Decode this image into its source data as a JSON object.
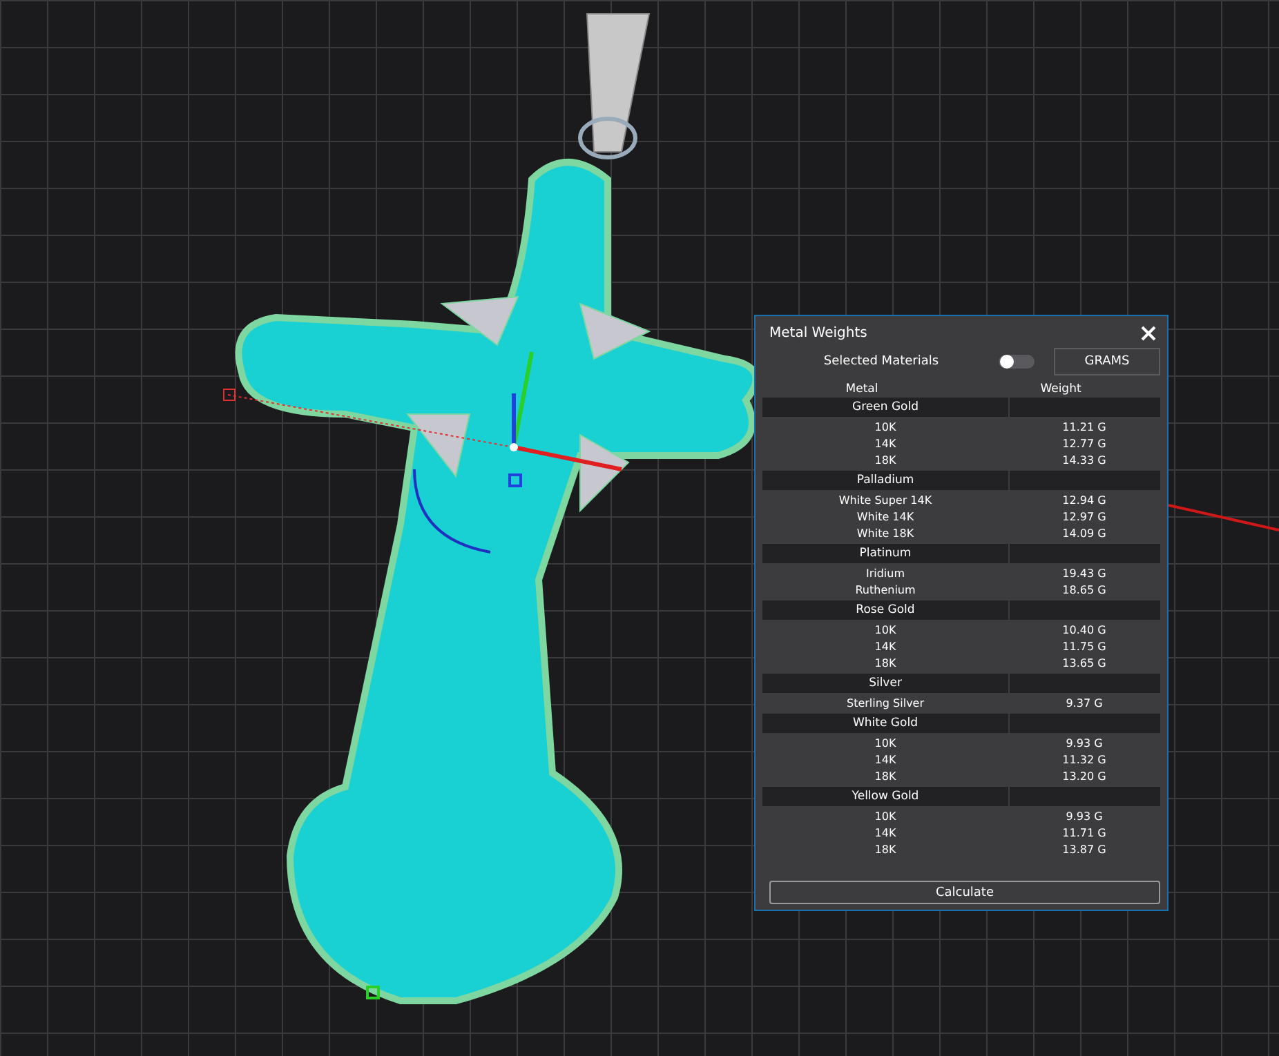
{
  "panel": {
    "title": "Metal Weights",
    "selected_materials": {
      "label": "Selected Materials",
      "on": false
    },
    "unit_button": "GRAMS",
    "columns": [
      "Metal",
      "Weight"
    ],
    "groups": [
      {
        "name": "Green Gold",
        "items": [
          {
            "metal": "10K",
            "weight": "11.21 G"
          },
          {
            "metal": "14K",
            "weight": "12.77 G"
          },
          {
            "metal": "18K",
            "weight": "14.33 G"
          }
        ]
      },
      {
        "name": "Palladium",
        "items": [
          {
            "metal": "White Super 14K",
            "weight": "12.94 G"
          },
          {
            "metal": "White 14K",
            "weight": "12.97 G"
          },
          {
            "metal": "White 18K",
            "weight": "14.09 G"
          }
        ]
      },
      {
        "name": "Platinum",
        "items": [
          {
            "metal": "Iridium",
            "weight": "19.43 G"
          },
          {
            "metal": "Ruthenium",
            "weight": "18.65 G"
          }
        ]
      },
      {
        "name": "Rose Gold",
        "items": [
          {
            "metal": "10K",
            "weight": "10.40 G"
          },
          {
            "metal": "14K",
            "weight": "11.75 G"
          },
          {
            "metal": "18K",
            "weight": "13.65 G"
          }
        ]
      },
      {
        "name": "Silver",
        "items": [
          {
            "metal": "Sterling Silver",
            "weight": "9.37 G"
          }
        ]
      },
      {
        "name": "White Gold",
        "items": [
          {
            "metal": "10K",
            "weight": "9.93 G"
          },
          {
            "metal": "14K",
            "weight": "11.32 G"
          },
          {
            "metal": "18K",
            "weight": "13.20 G"
          }
        ]
      },
      {
        "name": "Yellow Gold",
        "items": [
          {
            "metal": "10K",
            "weight": "9.93 G"
          },
          {
            "metal": "14K",
            "weight": "11.71 G"
          },
          {
            "metal": "18K",
            "weight": "13.87 G"
          }
        ]
      }
    ],
    "calculate_button": "Calculate"
  }
}
